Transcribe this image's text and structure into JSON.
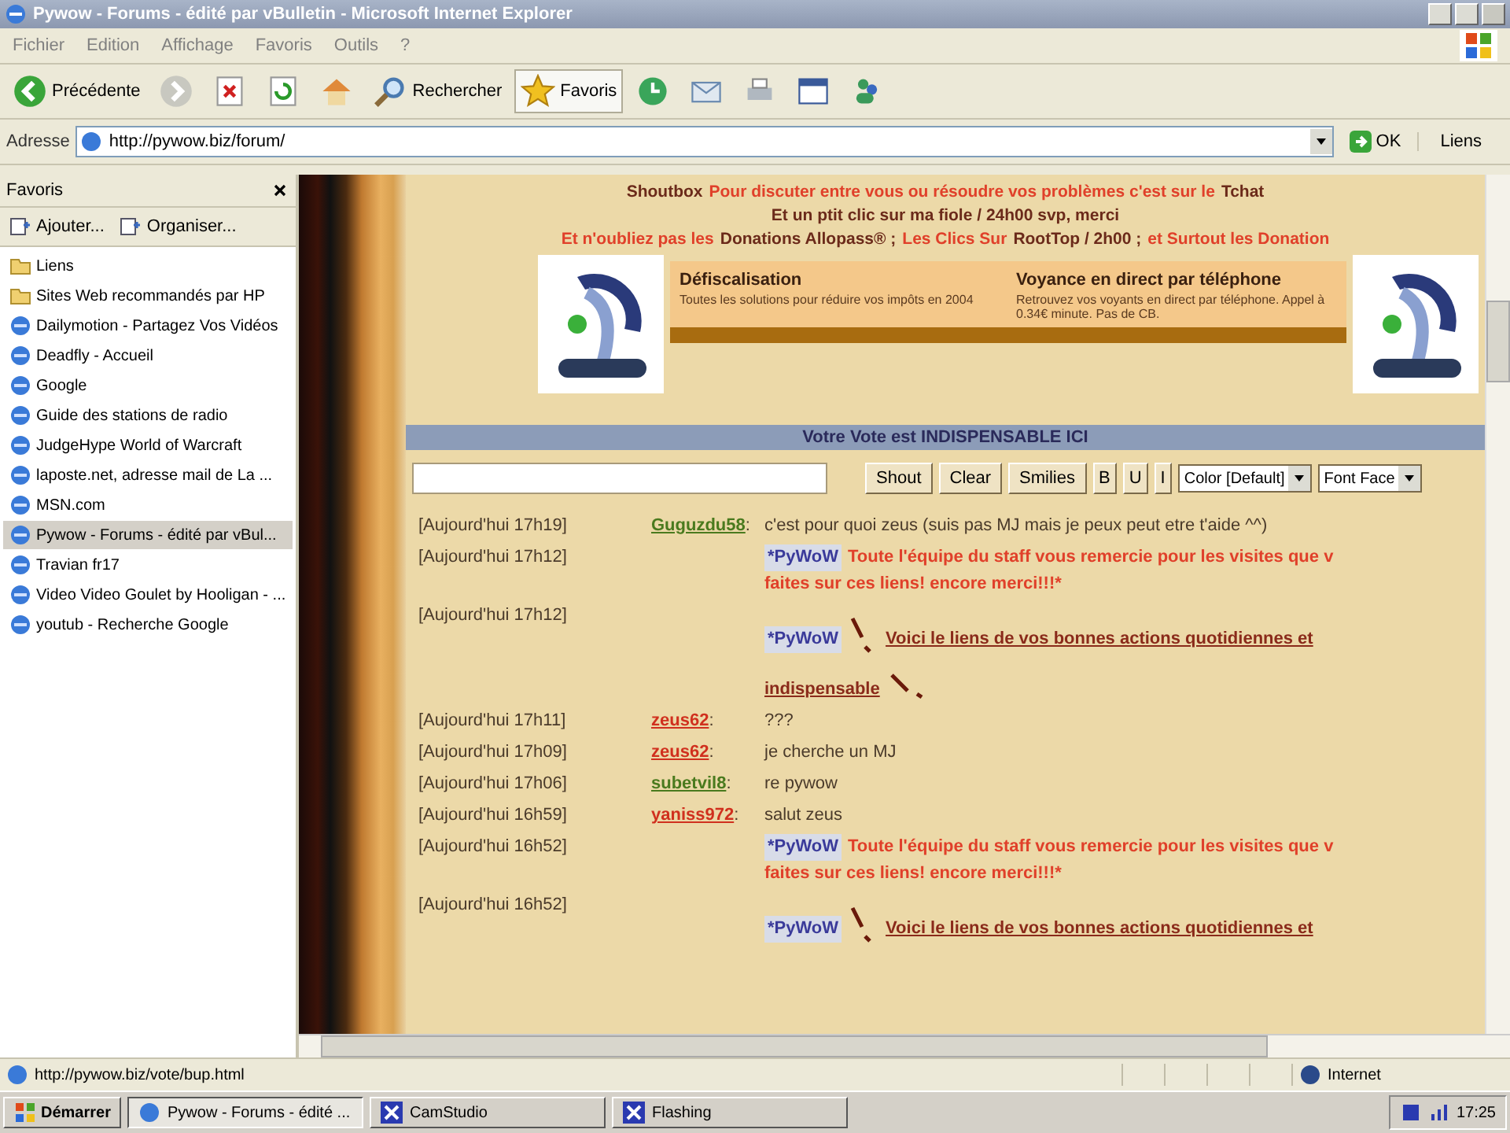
{
  "window": {
    "title": "Pywow - Forums - édité par vBulletin - Microsoft Internet Explorer"
  },
  "menu": [
    "Fichier",
    "Edition",
    "Affichage",
    "Favoris",
    "Outils",
    "?"
  ],
  "toolbar": [
    {
      "kind": "back",
      "label": "Précédente",
      "selected": false
    },
    {
      "kind": "forward",
      "selected": false
    },
    {
      "kind": "stop",
      "selected": false
    },
    {
      "kind": "refresh",
      "selected": false
    },
    {
      "kind": "home",
      "selected": false
    },
    {
      "kind": "search",
      "label": "Rechercher",
      "selected": false
    },
    {
      "kind": "favorites",
      "label": "Favoris",
      "selected": true
    },
    {
      "kind": "history",
      "selected": false
    },
    {
      "kind": "mail",
      "selected": false
    },
    {
      "kind": "print",
      "selected": false
    },
    {
      "kind": "edit",
      "selected": false
    },
    {
      "kind": "messenger",
      "selected": false
    }
  ],
  "address": {
    "label": "Adresse",
    "value": "http://pywow.biz/forum/",
    "go": "OK",
    "links": "Liens"
  },
  "sidebar": {
    "title": "Favoris",
    "actions": [
      "Ajouter...",
      "Organiser..."
    ],
    "items": [
      {
        "label": "Liens",
        "kind": "folder",
        "selected": false
      },
      {
        "label": "Sites Web recommandés par HP",
        "kind": "folder",
        "selected": false
      },
      {
        "label": "Dailymotion - Partagez Vos Vidéos",
        "kind": "page",
        "selected": false
      },
      {
        "label": "Deadfly - Accueil",
        "kind": "page",
        "selected": false
      },
      {
        "label": "Google",
        "kind": "page",
        "selected": false
      },
      {
        "label": "Guide des stations de radio",
        "kind": "page",
        "selected": false
      },
      {
        "label": "JudgeHype World of Warcraft",
        "kind": "page",
        "selected": false
      },
      {
        "label": "laposte.net, adresse mail de La ...",
        "kind": "page",
        "selected": false
      },
      {
        "label": "MSN.com",
        "kind": "page",
        "selected": false
      },
      {
        "label": "Pywow - Forums - édité par vBul...",
        "kind": "page",
        "selected": true
      },
      {
        "label": "Travian fr17",
        "kind": "page",
        "selected": false
      },
      {
        "label": "Video Video Goulet by Hooligan - ...",
        "kind": "page",
        "selected": false
      },
      {
        "label": "youtub - Recherche Google",
        "kind": "page",
        "selected": false
      }
    ]
  },
  "shoutbox": {
    "header": [
      [
        {
          "text": "Shoutbox",
          "color": "#6b2a1a"
        },
        {
          "text": "Pour discuter entre vous ou résoudre vos problèmes c'est sur le",
          "color": "#e0402a"
        },
        {
          "text": "Tchat",
          "color": "#6b2a1a"
        }
      ],
      [
        {
          "text": "Et un ptit clic sur ma fiole / 24h00 svp, merci",
          "color": "#6b2a1a"
        }
      ],
      [
        {
          "text": "Et n'oubliez pas les",
          "color": "#e0402a"
        },
        {
          "text": "Donations Allopass® ;",
          "color": "#6b2a1a"
        },
        {
          "text": "Les Clics Sur",
          "color": "#e0402a"
        },
        {
          "text": "RootTop / 2h00 ;",
          "color": "#6b2a1a"
        },
        {
          "text": "et Surtout les Donation",
          "color": "#e0402a"
        }
      ]
    ],
    "ads": [
      {
        "title": "Défiscalisation",
        "text": "Toutes les solutions pour réduire vos impôts en 2004"
      },
      {
        "title": "Voyance en direct par téléphone",
        "text": "Retrouvez vos voyants en direct par téléphone. Appel à 0.34€ minute. Pas de CB."
      }
    ],
    "vote": "Votre Vote est INDISPENSABLE ICI",
    "form": {
      "buttons": [
        "Shout",
        "Clear",
        "Smilies"
      ],
      "format": [
        "B",
        "U",
        "I"
      ],
      "selects": [
        "Color [Default]",
        "Font Face"
      ]
    },
    "messages": [
      {
        "time": "[Aujourd'hui 17h19]",
        "user": "Guguzdu58",
        "color": "#4a7a1e",
        "sep": ":",
        "kind": "plain",
        "text": "c'est pour quoi zeus (suis pas MJ mais je peux peut etre t'aide ^^)"
      },
      {
        "time": "[Aujourd'hui 17h12]",
        "kind": "staff",
        "tag": "*PyWoW",
        "lines": [
          "Toute l'équipe du staff vous remercie pour les visites que v",
          "faites sur ces liens! encore merci!!!*"
        ]
      },
      {
        "time": "[Aujourd'hui 17h12]",
        "kind": "link",
        "tag": "*PyWoW",
        "lines": [
          "Voici le liens de vos bonnes actions quotidiennes et",
          "indispensable"
        ]
      },
      {
        "time": "[Aujourd'hui 17h11]",
        "user": "zeus62",
        "color": "#d0301e",
        "sep": ":",
        "kind": "plain",
        "text": "???"
      },
      {
        "time": "[Aujourd'hui 17h09]",
        "user": "zeus62",
        "color": "#d0301e",
        "sep": ":",
        "kind": "plain",
        "text": "je cherche un MJ"
      },
      {
        "time": "[Aujourd'hui 17h06]",
        "user": "subetvil8",
        "color": "#4a7a1e",
        "sep": ":",
        "kind": "plain",
        "text": "re pywow"
      },
      {
        "time": "[Aujourd'hui 16h59]",
        "user": "yaniss972",
        "color": "#d0301e",
        "sep": ":",
        "kind": "plain",
        "text": "salut zeus"
      },
      {
        "time": "[Aujourd'hui 16h52]",
        "kind": "staff",
        "tag": "*PyWoW",
        "lines": [
          "Toute l'équipe du staff vous remercie pour les visites que v",
          "faites sur ces liens! encore merci!!!*"
        ]
      },
      {
        "time": "[Aujourd'hui 16h52]",
        "kind": "link",
        "tag": "*PyWoW",
        "lines": [
          "Voici le liens de vos bonnes actions quotidiennes et"
        ]
      }
    ]
  },
  "status": {
    "url": "http://pywow.biz/vote/bup.html",
    "zone": "Internet"
  },
  "taskbar": {
    "start": "Démarrer",
    "tasks": [
      {
        "label": "Pywow - Forums - édité ...",
        "kind": "browser",
        "selected": true
      },
      {
        "label": "CamStudio",
        "kind": "app",
        "selected": false
      },
      {
        "label": "Flashing",
        "kind": "app",
        "selected": false
      }
    ],
    "clock": "17:25"
  }
}
